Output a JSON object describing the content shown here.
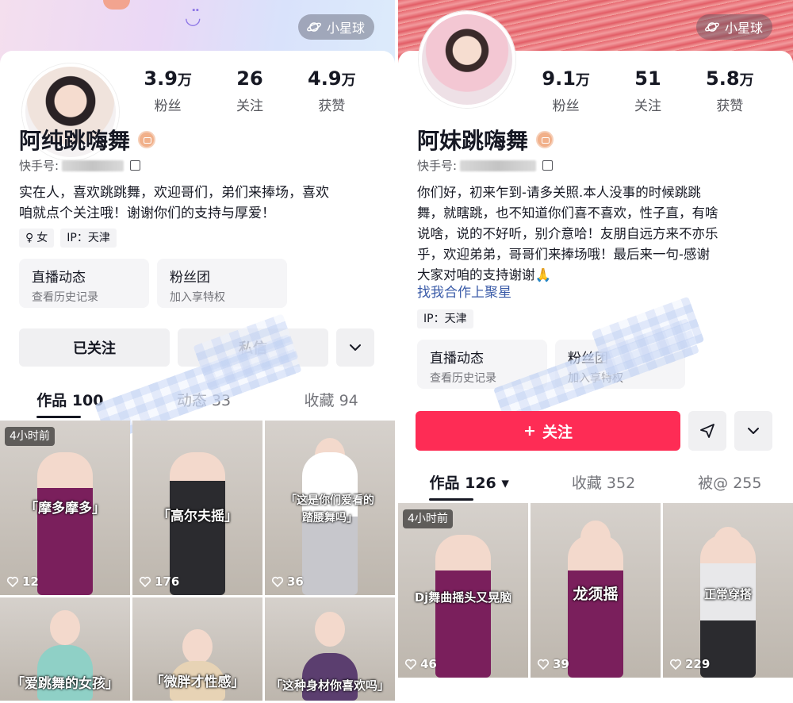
{
  "left_profile": {
    "planet_label": "小星球",
    "stats": [
      {
        "value": "3.9",
        "unit": "万",
        "label": "粉丝"
      },
      {
        "value": "26",
        "unit": "",
        "label": "关注"
      },
      {
        "value": "4.9",
        "unit": "万",
        "label": "获赞"
      }
    ],
    "nickname": "阿纯跳嗨舞",
    "id_prefix": "快手号:",
    "bio": "实在人，喜欢跳跳舞，欢迎哥们，弟们来捧场，喜欢\n咱就点个关注哦！谢谢你们的支持与厚爱！",
    "tags": [
      {
        "icon": "female-icon",
        "symbol": "♀",
        "text": "女"
      },
      {
        "icon": "",
        "symbol": "",
        "text": "IP：天津"
      }
    ],
    "features": [
      {
        "title": "直播动态",
        "subtitle": "查看历史记录"
      },
      {
        "title": "粉丝团",
        "subtitle": "加入享特权"
      }
    ],
    "followed_label": "已关注",
    "second_button_label": "私信",
    "tabs": [
      {
        "label": "作品 100",
        "active": true
      },
      {
        "label": "动态 33",
        "active": false
      },
      {
        "label": "收藏 94",
        "active": false
      }
    ],
    "works": [
      {
        "caption": "「摩多摩多」",
        "likes": "12",
        "pill": "4小时前",
        "outfit": "#7a1f5c"
      },
      {
        "caption": "「高尔夫摇」",
        "likes": "176",
        "pill": "",
        "outfit": "#2b2b2f"
      },
      {
        "caption": "「这是你们爱看的\n踏腰舞吗」",
        "likes": "36",
        "pill": "",
        "outfit": "#c7c7cc"
      },
      {
        "caption": "「爱跳舞的女孩」",
        "likes": "",
        "pill": "",
        "outfit": "#8fd0c6"
      },
      {
        "caption": "「微胖才性感」",
        "likes": "",
        "pill": "",
        "outfit": "#e7d3b5"
      },
      {
        "caption": "「这种身材你喜欢吗」",
        "likes": "",
        "pill": "",
        "outfit": "#5b3e6f"
      }
    ]
  },
  "right_profile": {
    "planet_label": "小星球",
    "stats": [
      {
        "value": "9.1",
        "unit": "万",
        "label": "粉丝"
      },
      {
        "value": "51",
        "unit": "",
        "label": "关注"
      },
      {
        "value": "5.8",
        "unit": "万",
        "label": "获赞"
      }
    ],
    "nickname": "阿妹跳嗨舞",
    "id_prefix": "快手号:",
    "bio": "你们好，初来乍到-请多关照.本人没事的时候跳跳\n舞，就瞎跳，也不知道你们喜不喜欢，性子直，有啥\n说啥，说的不好听，别介意哈！友朋自远方来不亦乐\n乎，欢迎弟弟，哥哥们来捧场哦！最后来一句-感谢\n大家对咱的支持谢谢🙏",
    "bio_link": "找我合作上聚星",
    "tags": [
      {
        "icon": "",
        "symbol": "",
        "text": "IP：天津"
      }
    ],
    "features": [
      {
        "title": "直播动态",
        "subtitle": "查看历史记录"
      },
      {
        "title": "粉丝团",
        "subtitle": "加入享特权"
      }
    ],
    "follow_label": "关注",
    "tabs": [
      {
        "label": "作品 126 ▾",
        "active": true
      },
      {
        "label": "收藏 352",
        "active": false
      },
      {
        "label": "被@ 255",
        "active": false
      }
    ],
    "works": [
      {
        "caption": "Dj舞曲摇头又晃脑",
        "likes": "46",
        "pill": "4小时前",
        "outfit": "#7a1f5c"
      },
      {
        "caption": "龙须摇",
        "likes": "39",
        "pill": "",
        "outfit": "#7a1f5c"
      },
      {
        "caption": "正常穿搭",
        "likes": "229",
        "pill": "",
        "outfit": "#e8e8ea"
      }
    ]
  },
  "colors": {
    "primary_red": "#fe2c55",
    "link_blue": "#3a5ba8",
    "text_dark": "#161823",
    "text_gray": "#73747a"
  }
}
